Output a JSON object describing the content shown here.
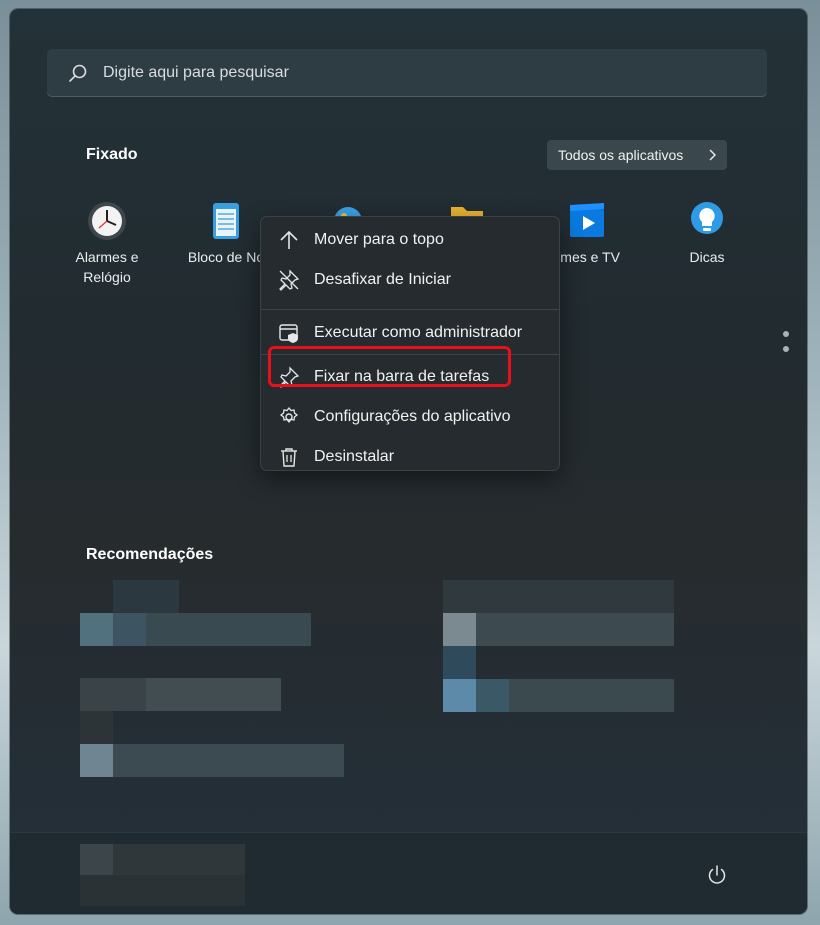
{
  "search": {
    "placeholder": "Digite aqui para pesquisar"
  },
  "pinned": {
    "title": "Fixado",
    "all_apps_label": "Todos os aplicativos",
    "apps": [
      {
        "label": "Alarmes e Relógio",
        "icon": "clock-icon"
      },
      {
        "label": "Bloco de No",
        "icon": "notepad-icon"
      },
      {
        "label": "",
        "icon": "paint-icon"
      },
      {
        "label": "",
        "icon": "folder-icon"
      },
      {
        "label": "ilmes e TV",
        "icon": "movies-icon"
      },
      {
        "label": "Dicas",
        "icon": "lightbulb-icon"
      }
    ]
  },
  "context_menu": {
    "items": [
      {
        "label": "Mover para o topo",
        "icon": "arrow-up-icon"
      },
      {
        "label": "Desafixar de Iniciar",
        "icon": "unpin-icon"
      },
      {
        "label": "Executar como administrador",
        "icon": "admin-shield-icon"
      },
      {
        "label": "Fixar na barra de tarefas",
        "icon": "pin-icon",
        "highlighted": true
      },
      {
        "label": "Configurações do aplicativo",
        "icon": "gear-icon"
      },
      {
        "label": "Desinstalar",
        "icon": "trash-icon"
      }
    ]
  },
  "recommendations": {
    "title": "Recomendações"
  },
  "footer": {
    "power_icon": "power-icon"
  },
  "colors": {
    "highlight": "#e8101a",
    "accent_blue": "#0a7ae0"
  }
}
